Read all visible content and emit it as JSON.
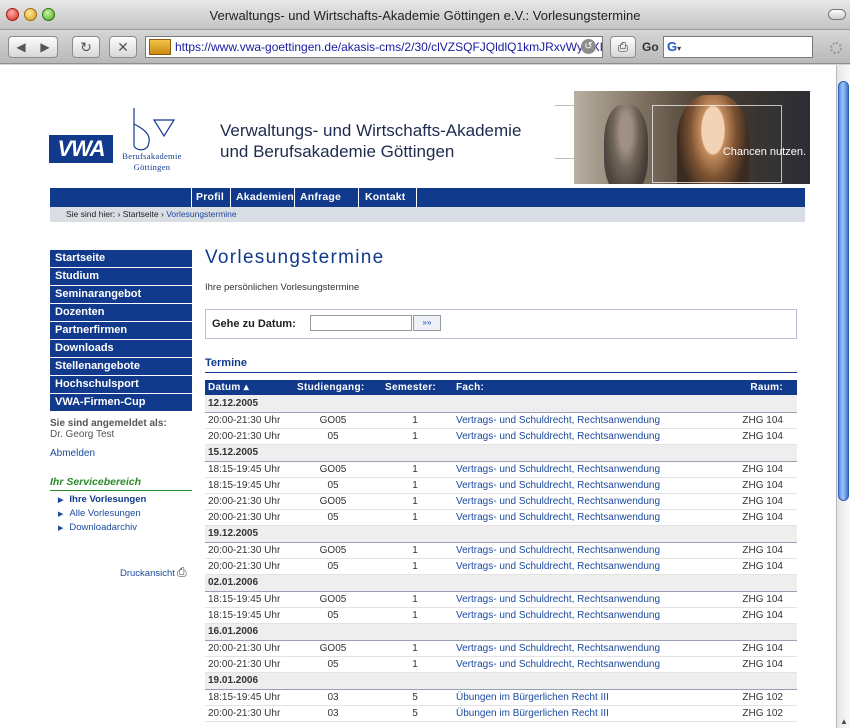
{
  "window": {
    "title": "Verwaltungs- und Wirtschafts-Akademie Göttingen e.V.: Vorlesungstermine"
  },
  "browser": {
    "url": "https://www.vwa-goettingen.de/akasis-cms/2/30/clVZSQFJQldlQ1kmJRxvWyNXH0A/",
    "go_label": "Go",
    "search_engine_glyph": "G"
  },
  "header": {
    "logo_text": "VWA",
    "logo_sub1": "Berufsakademie",
    "logo_sub2": "Göttingen",
    "site_title_line1": "Verwaltungs- und Wirtschafts-Akademie",
    "site_title_line2": "und Berufsakademie Göttingen",
    "slogan": "Chancen nutzen."
  },
  "nav": {
    "items": [
      "Profil",
      "Akademien",
      "Anfrage",
      "Kontakt"
    ]
  },
  "breadcrumb": {
    "lead": "Sie sind hier:",
    "items": [
      "Startseite",
      "Vorlesungstermine"
    ],
    "sep": "›"
  },
  "sidebar": {
    "menu": [
      "Startseite",
      "Studium",
      "Seminarangebot",
      "Dozenten",
      "Partnerfirmen",
      "Downloads",
      "Stellenangebote",
      "Hochschulsport",
      "VWA-Firmen-Cup"
    ],
    "login_heading": "Sie sind angemeldet als:",
    "login_name": "Dr. Georg Test",
    "logout": "Abmelden",
    "service_heading": "Ihr Servicebereich",
    "service_items": [
      "Ihre Vorlesungen",
      "Alle Vorlesungen",
      "Downloadarchiv"
    ],
    "print_label": "Druckansicht"
  },
  "main": {
    "title": "Vorlesungstermine",
    "subtitle": "Ihre persönlichen Vorlesungstermine",
    "goto_label": "Gehe zu Datum:",
    "goto_button": "»»",
    "goto_value": "",
    "section_title": "Termine",
    "columns": [
      "Datum ▴",
      "Studiengang:",
      "Semester:",
      "Fach:",
      "Raum:"
    ],
    "groups": [
      {
        "date": "12.12.2005",
        "rows": [
          [
            "20:00-21:30 Uhr",
            "GO05",
            "1",
            "Vertrags- und Schuldrecht, Rechtsanwendung",
            "ZHG 104"
          ],
          [
            "20:00-21:30 Uhr",
            "05",
            "1",
            "Vertrags- und Schuldrecht, Rechtsanwendung",
            "ZHG 104"
          ]
        ]
      },
      {
        "date": "15.12.2005",
        "rows": [
          [
            "18:15-19:45 Uhr",
            "GO05",
            "1",
            "Vertrags- und Schuldrecht, Rechtsanwendung",
            "ZHG 104"
          ],
          [
            "18:15-19:45 Uhr",
            "05",
            "1",
            "Vertrags- und Schuldrecht, Rechtsanwendung",
            "ZHG 104"
          ],
          [
            "20:00-21:30 Uhr",
            "GO05",
            "1",
            "Vertrags- und Schuldrecht, Rechtsanwendung",
            "ZHG 104"
          ],
          [
            "20:00-21:30 Uhr",
            "05",
            "1",
            "Vertrags- und Schuldrecht, Rechtsanwendung",
            "ZHG 104"
          ]
        ]
      },
      {
        "date": "19.12.2005",
        "rows": [
          [
            "20:00-21:30 Uhr",
            "GO05",
            "1",
            "Vertrags- und Schuldrecht, Rechtsanwendung",
            "ZHG 104"
          ],
          [
            "20:00-21:30 Uhr",
            "05",
            "1",
            "Vertrags- und Schuldrecht, Rechtsanwendung",
            "ZHG 104"
          ]
        ]
      },
      {
        "date": "02.01.2006",
        "rows": [
          [
            "18:15-19:45 Uhr",
            "GO05",
            "1",
            "Vertrags- und Schuldrecht, Rechtsanwendung",
            "ZHG 104"
          ],
          [
            "18:15-19:45 Uhr",
            "05",
            "1",
            "Vertrags- und Schuldrecht, Rechtsanwendung",
            "ZHG 104"
          ]
        ]
      },
      {
        "date": "16.01.2006",
        "rows": [
          [
            "20:00-21:30 Uhr",
            "GO05",
            "1",
            "Vertrags- und Schuldrecht, Rechtsanwendung",
            "ZHG 104"
          ],
          [
            "20:00-21:30 Uhr",
            "05",
            "1",
            "Vertrags- und Schuldrecht, Rechtsanwendung",
            "ZHG 104"
          ]
        ]
      },
      {
        "date": "19.01.2006",
        "rows": [
          [
            "18:15-19:45 Uhr",
            "03",
            "5",
            "Übungen im Bürgerlichen Recht III",
            "ZHG 102"
          ],
          [
            "20:00-21:30 Uhr",
            "03",
            "5",
            "Übungen im Bürgerlichen Recht III",
            "ZHG 102"
          ]
        ]
      }
    ]
  },
  "colors": {
    "brand": "#123a8c",
    "link": "#1c4aa0",
    "service_green": "#2a8a2a"
  }
}
